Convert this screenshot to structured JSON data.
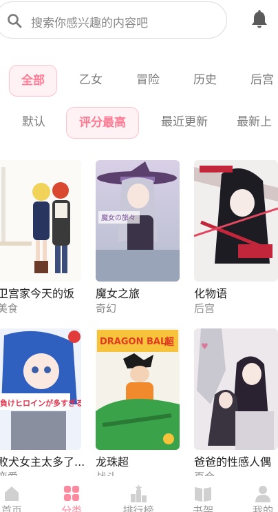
{
  "search": {
    "placeholder": "搜索你感兴趣的内容吧"
  },
  "category_tabs": [
    "全部",
    "乙女",
    "冒险",
    "历史",
    "后宫"
  ],
  "sort_tabs": [
    "默认",
    "评分最高",
    "最近更新",
    "最新上"
  ],
  "active": {
    "category": "全部",
    "sort": "评分最高"
  },
  "comics": [
    {
      "title": "卫宫家今天的饭",
      "genre": "美食"
    },
    {
      "title": "魔女之旅",
      "genre": "奇幻"
    },
    {
      "title": "化物语",
      "genre": "后宫"
    },
    {
      "title": "败犬女主太多了...",
      "genre": "恋爱"
    },
    {
      "title": "龙珠超",
      "genre": "战斗"
    },
    {
      "title": "爸爸的性感人偶",
      "genre": "百合"
    }
  ],
  "cover_text": {
    "dragon_ball": "DRAGON BALL",
    "dragon_ball_sub": "超",
    "witch_journey": "魔女の旅々",
    "make_heroine": "負けヒロインが多すぎる!"
  },
  "bottom_nav": [
    {
      "label": "首页",
      "icon": "home-icon"
    },
    {
      "label": "分类",
      "icon": "category-icon"
    },
    {
      "label": "排行榜",
      "icon": "ranking-icon"
    },
    {
      "label": "书架",
      "icon": "bookshelf-icon"
    },
    {
      "label": "我的",
      "icon": "profile-icon"
    }
  ],
  "colors": {
    "accent": "#ff7a93",
    "accent_bg": "#fff2f4",
    "muted": "#8a8a8a"
  }
}
